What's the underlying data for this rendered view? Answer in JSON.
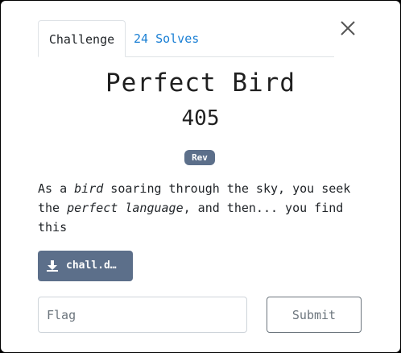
{
  "tabs": [
    {
      "label": "Challenge",
      "active": true
    },
    {
      "label": "24 Solves",
      "active": false
    }
  ],
  "challenge": {
    "name": "Perfect Bird",
    "points": "405",
    "category_badge": "Rev"
  },
  "description": {
    "line1_a": "As a ",
    "line1_em": "bird",
    "line1_b": " soaring through the sky, you seek the ",
    "line1_em2": "perfect language",
    "line1_c": ", and then... you find this"
  },
  "file": {
    "label": "chall.d…",
    "icon": "download-icon"
  },
  "flag_input": {
    "placeholder": "Flag",
    "value": ""
  },
  "submit": {
    "label": "Submit"
  },
  "colors": {
    "badge": "#5c6f8a",
    "link": "#1a7fd4",
    "file_button": "#5c6f8a"
  }
}
